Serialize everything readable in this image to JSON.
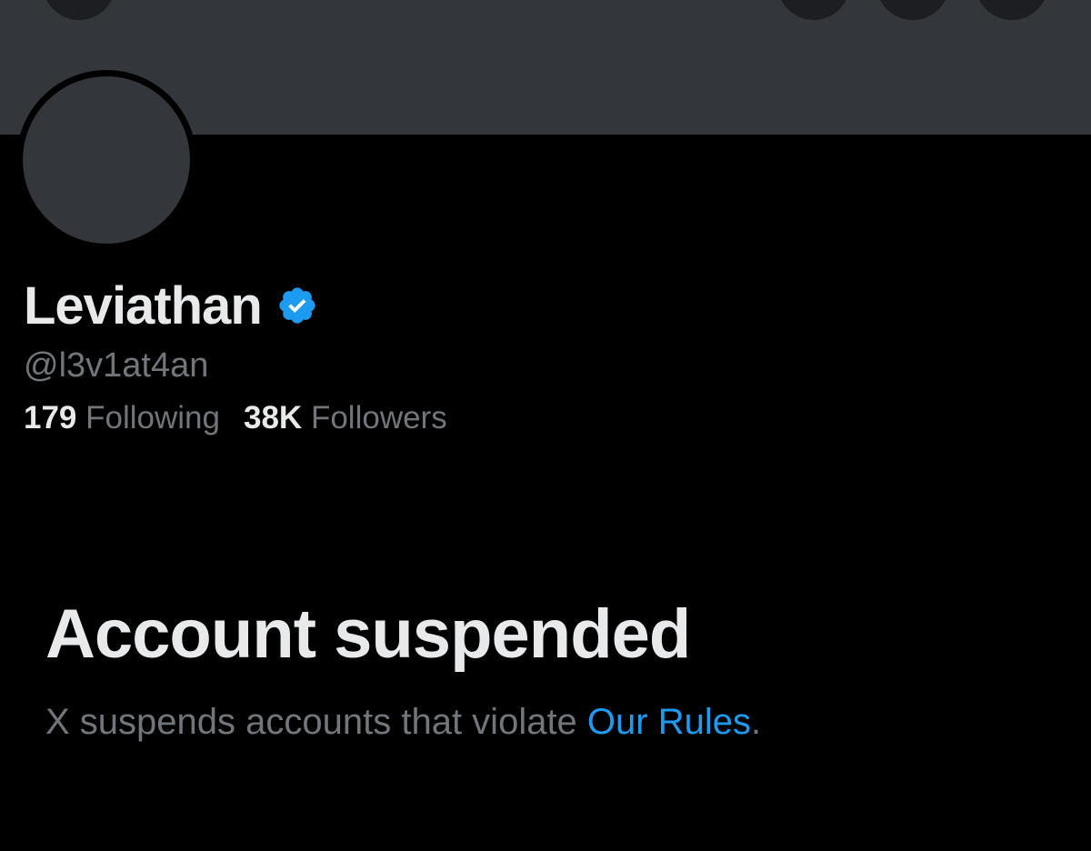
{
  "profile": {
    "display_name": "Leviathan",
    "handle": "@l3v1at4an",
    "verified_icon": "verified-badge-icon",
    "verified_color": "#1d9bf0"
  },
  "stats": {
    "following_count": "179",
    "following_label": "Following",
    "followers_count": "38K",
    "followers_label": "Followers"
  },
  "suspension": {
    "title": "Account suspended",
    "description_prefix": "X suspends accounts that violate ",
    "rules_link": "Our Rules",
    "description_suffix": "."
  },
  "colors": {
    "background": "#000000",
    "banner": "#33363a",
    "primary_text": "#e7e9ea",
    "secondary_text": "#71767b",
    "accent": "#1d9bf0"
  }
}
